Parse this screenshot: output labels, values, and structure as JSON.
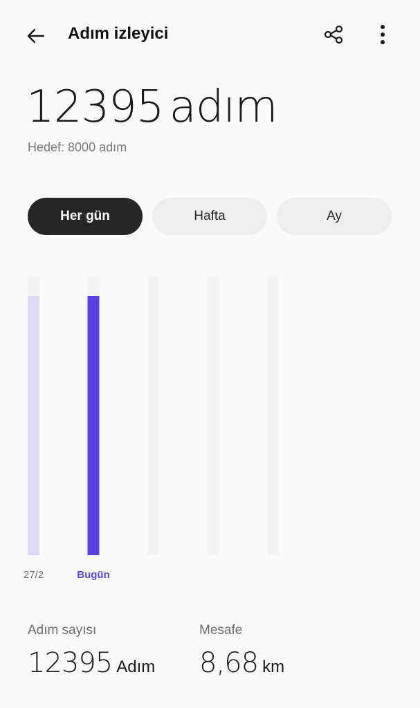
{
  "header": {
    "title": "Adım izleyici",
    "back_icon": "arrow-left-icon",
    "share_icon": "share-icon",
    "more_icon": "more-vertical-icon"
  },
  "summary": {
    "steps": "12395",
    "steps_unit": "adım",
    "goal_text": "Hedef: 8000 adım"
  },
  "tabs": [
    {
      "label": "Her gün",
      "active": true
    },
    {
      "label": "Hafta",
      "active": false
    },
    {
      "label": "Ay",
      "active": false
    }
  ],
  "chart_data": {
    "type": "bar",
    "categories": [
      "27/2",
      "Bugün",
      "",
      "",
      ""
    ],
    "values": [
      12395,
      12395,
      null,
      null,
      null
    ],
    "goal": 8000,
    "highlight_index": 1,
    "colors": {
      "highlight": "#5b3fe0",
      "past": "#dcd9f0",
      "track": "#f3f3f3",
      "today_label": "#5b3fe0",
      "label": "#6e6e6e"
    }
  },
  "stats": {
    "steps_label": "Adım sayısı",
    "steps_value": "12395",
    "steps_unit": "Adım",
    "distance_label": "Mesafe",
    "distance_value": "8,68",
    "distance_unit": "km"
  }
}
